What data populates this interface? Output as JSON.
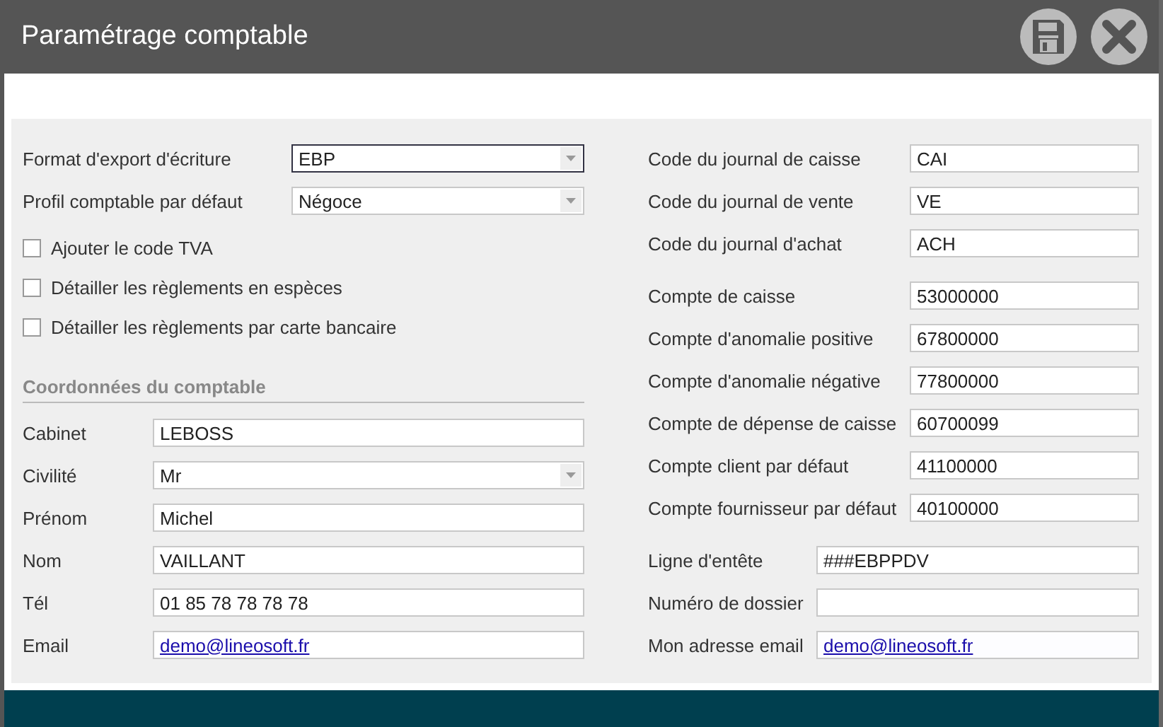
{
  "window": {
    "title": "Paramétrage comptable"
  },
  "export_settings": [
    {
      "label": "Format d'export d'écriture",
      "value": "EBP",
      "kind": "select",
      "focused": true
    },
    {
      "label": "Profil comptable par défaut",
      "value": "Négoce",
      "kind": "select",
      "focused": false
    }
  ],
  "options": [
    {
      "label": "Ajouter le code TVA",
      "checked": false
    },
    {
      "label": "Détailler les règlements en espèces",
      "checked": false
    },
    {
      "label": "Détailler les règlements par carte bancaire",
      "checked": false
    }
  ],
  "accountant": {
    "heading": "Coordonnées du comptable",
    "fields": [
      {
        "label": "Cabinet",
        "value": "LEBOSS",
        "kind": "text"
      },
      {
        "label": "Civilité",
        "value": "Mr",
        "kind": "select"
      },
      {
        "label": "Prénom",
        "value": "Michel",
        "kind": "text"
      },
      {
        "label": "Nom",
        "value": "VAILLANT",
        "kind": "text"
      },
      {
        "label": "Tél",
        "value": "01 85 78 78 78 78",
        "kind": "text"
      },
      {
        "label": "Email",
        "value": "demo@lineosoft.fr",
        "kind": "email"
      }
    ]
  },
  "journals": [
    {
      "label": "Code du journal de caisse",
      "value": "CAI"
    },
    {
      "label": "Code du journal de vente",
      "value": "VE"
    },
    {
      "label": "Code du journal d'achat",
      "value": "ACH"
    }
  ],
  "accounts": [
    {
      "label": "Compte de caisse",
      "value": "53000000"
    },
    {
      "label": "Compte d'anomalie positive",
      "value": "67800000"
    },
    {
      "label": "Compte d'anomalie négative",
      "value": "77800000"
    },
    {
      "label": "Compte de dépense de caisse",
      "value": "60700099"
    },
    {
      "label": "Compte client par défaut",
      "value": "41100000"
    },
    {
      "label": "Compte fournisseur par défaut",
      "value": "40100000"
    }
  ],
  "export_file": [
    {
      "label": "Ligne d'entête",
      "value": "###EBPPDV",
      "kind": "text"
    },
    {
      "label": "Numéro de dossier",
      "kind": "text"
    },
    {
      "label": "Mon adresse email",
      "value": "demo@lineosoft.fr",
      "kind": "email"
    }
  ]
}
